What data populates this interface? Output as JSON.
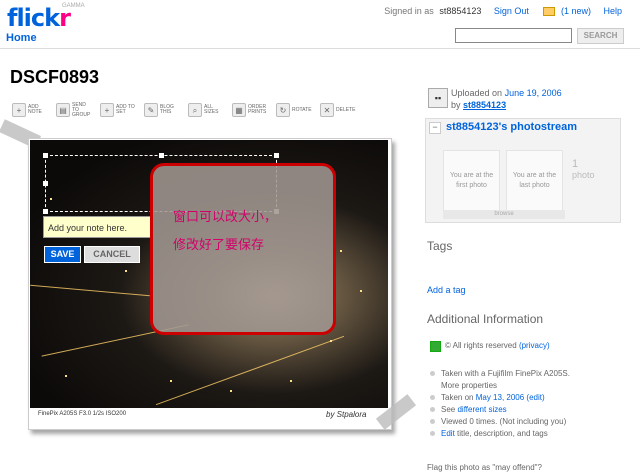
{
  "header": {
    "logo_main": "flick",
    "logo_r": "r",
    "gamma": "GAMMA",
    "home": "Home",
    "signed_in_as": "Signed in as",
    "username": "st8854123",
    "sign_out": "Sign Out",
    "mail_count": "(1 new)",
    "help": "Help",
    "search_button": "SEARCH"
  },
  "photo": {
    "title": "DSCF0893",
    "caption": "FinePix A205S F3.0 1/2s ISO200",
    "byline": "by Stpalora"
  },
  "toolbar": [
    {
      "icon": "add-note-icon",
      "glyph": "+",
      "label": "ADD NOTE"
    },
    {
      "icon": "send-to-group-icon",
      "glyph": "▤",
      "label": "SEND TO GROUP"
    },
    {
      "icon": "add-to-set-icon",
      "glyph": "+",
      "label": "ADD TO SET"
    },
    {
      "icon": "blog-this-icon",
      "glyph": "✎",
      "label": "BLOG THIS"
    },
    {
      "icon": "all-sizes-icon",
      "glyph": "⌕",
      "label": "ALL SIZES"
    },
    {
      "icon": "order-prints-icon",
      "glyph": "▦",
      "label": "ORDER PRINTS"
    },
    {
      "icon": "rotate-icon",
      "glyph": "↻",
      "label": "ROTATE"
    },
    {
      "icon": "delete-icon",
      "glyph": "✕",
      "label": "DELETE"
    }
  ],
  "note": {
    "placeholder": "Add your note here.",
    "save": "SAVE",
    "cancel": "CANCEL"
  },
  "overlay": {
    "line1": "窗口可以改大小，",
    "line2": "修改好了要保存"
  },
  "sidebar": {
    "uploaded_on": "Uploaded on",
    "upload_date": "June 19, 2006",
    "by": "by",
    "owner": "st8854123",
    "stream_toggle": "−",
    "stream_title": "st8854123's photostream",
    "first_thumb": "You are at the first photo",
    "last_thumb": "You are at the last photo",
    "count": "1",
    "count_label": "photo",
    "browse": "browse",
    "tags_heading": "Tags",
    "add_tag": "Add a tag",
    "additional_heading": "Additional Information",
    "rights": "© All rights reserved",
    "privacy": "(privacy)",
    "taken_with": "Taken with a Fujifilm FinePix A205S.",
    "more_properties": "More properties",
    "taken_on": "Taken on",
    "taken_date": "May 13, 2006",
    "edit": "(edit)",
    "see": "See",
    "different_sizes": "different sizes",
    "viewed": "Viewed 0 times. (Not including you)",
    "edit_link": "Edit",
    "edit_rest": "title, description, and tags",
    "flag": "Flag this photo as \"may offend\"?"
  }
}
